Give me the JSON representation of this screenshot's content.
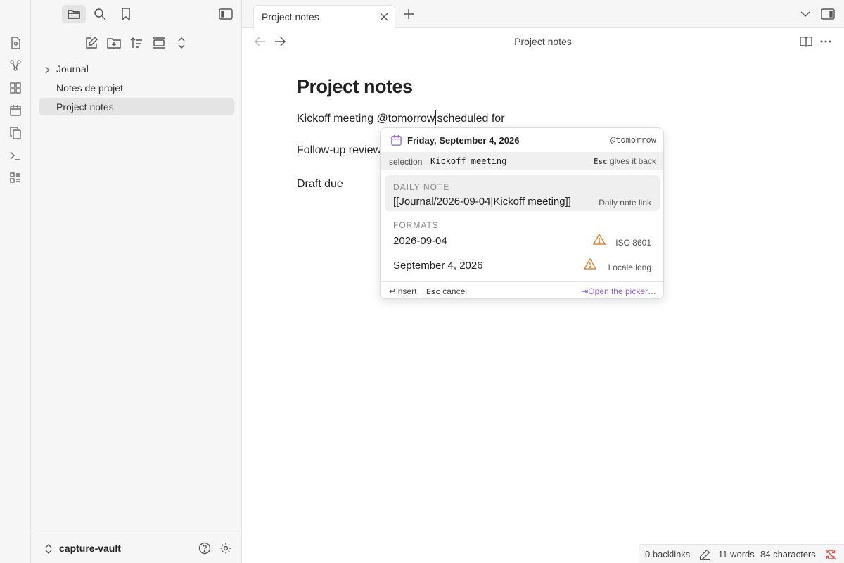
{
  "tab": {
    "title": "Project notes"
  },
  "view": {
    "title": "Project notes"
  },
  "sidebar": {
    "items": [
      {
        "label": "Journal",
        "type": "folder"
      },
      {
        "label": "Notes de projet",
        "type": "file"
      },
      {
        "label": "Project notes",
        "type": "file",
        "selected": true
      }
    ],
    "vault_name": "capture-vault"
  },
  "editor": {
    "heading": "Project notes",
    "line1_before": "Kickoff meeting @tomorrow",
    "line1_after": "scheduled for",
    "line2": "Follow-up review",
    "line3": "Draft due"
  },
  "popup": {
    "date": "Friday, September 4, 2026",
    "trigger": "@tomorrow",
    "selection_label": "selection",
    "selection_text": "Kickoff meeting",
    "selection_hint_key": "Esc",
    "selection_hint": "gives it back",
    "daily_note_label": "DAILY NOTE",
    "daily_note_value": "[[Journal/2026-09-04|Kickoff meeting]]",
    "daily_note_hint": "Daily note link",
    "formats_label": "FORMATS",
    "formats": [
      {
        "value": "2026-09-04",
        "hint": "ISO 8601",
        "warning": true
      },
      {
        "value": "September 4, 2026",
        "hint": "Locale long",
        "warning": true
      }
    ],
    "footer": {
      "insert_key": "↵",
      "insert_label": "insert",
      "cancel_key": "Esc",
      "cancel_label": "cancel",
      "picker_key": "⇥",
      "picker_label": "Open the picker…"
    }
  },
  "statusbar": {
    "backlinks": "0 backlinks",
    "words": "11 words",
    "characters": "84 characters"
  },
  "colors": {
    "accent": "#8a63d2",
    "warning": "#e0822b",
    "sync_error": "#e0534a"
  }
}
